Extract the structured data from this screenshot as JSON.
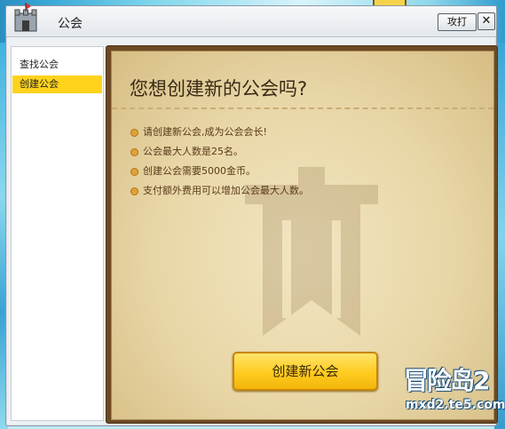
{
  "window": {
    "title": "公会",
    "open_button": "攻打",
    "close_glyph": "✕"
  },
  "sidebar": {
    "items": [
      {
        "label": "查找公会",
        "active": false
      },
      {
        "label": "创建公会",
        "active": true
      }
    ]
  },
  "main": {
    "heading": "您想创建新的公会吗?",
    "bullets": [
      "请创建新公会,成为公会会长!",
      "公会最大人数是25名。",
      "创建公会需要5000金币。",
      "支付额外费用可以增加公会最大人数。"
    ],
    "create_button": "创建新公会"
  },
  "watermark": {
    "logo": "冒险岛2",
    "url": "mxd2.te5.com"
  },
  "colors": {
    "accent": "#ffd21c",
    "panel_border": "#6d4a24",
    "parchment": "#e8d6a6",
    "bullet_dot": "#e2a23a"
  }
}
